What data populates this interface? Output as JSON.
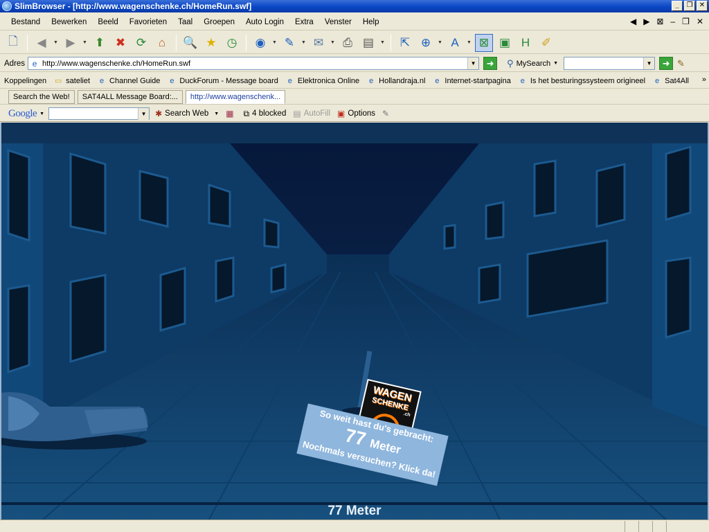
{
  "window": {
    "title": "SlimBrowser - [http://www.wagenschenke.ch/HomeRun.swf]"
  },
  "menu": [
    "Bestand",
    "Bewerken",
    "Beeld",
    "Favorieten",
    "Taal",
    "Groepen",
    "Auto Login",
    "Extra",
    "Venster",
    "Help"
  ],
  "address": {
    "label": "Adres",
    "url": "http://www.wagenschenke.ch/HomeRun.swf"
  },
  "mysearch": {
    "label": "MySearch",
    "value": ""
  },
  "links": {
    "label": "Koppelingen",
    "items": [
      "sateliet",
      "Channel Guide",
      "DuckForum - Message board",
      "Elektronica Online",
      "Hollandraja.nl",
      "Internet-startpagina",
      "Is het besturingssysteem origineel",
      "Sat4All"
    ],
    "more": "»"
  },
  "tabs": [
    "Search the Web!",
    "SAT4ALL Message Board:...",
    "http://www.wagenschenk..."
  ],
  "google": {
    "logo": "Google",
    "search_value": "",
    "search_web": "Search Web",
    "blocked": "4 blocked",
    "autofill": "AutoFill",
    "options": "Options"
  },
  "game": {
    "logo_line1": "WAGEN",
    "logo_line2": "SCHENKE",
    "logo_suffix": ".ch",
    "sign_line1": "So weit hast du's gebracht:",
    "sign_value": "77",
    "sign_unit": "Meter",
    "sign_line3": "Nochmals versuchen? Klick da!",
    "bottom_meter": "77 Meter"
  },
  "status": {
    "text": ""
  },
  "colors": {
    "titlebar": "#0a46c4",
    "chrome": "#ece9d8",
    "game_sky": "#0b2c4d",
    "sign": "#8fb6dd",
    "logo_accent": "#ff7a00"
  }
}
